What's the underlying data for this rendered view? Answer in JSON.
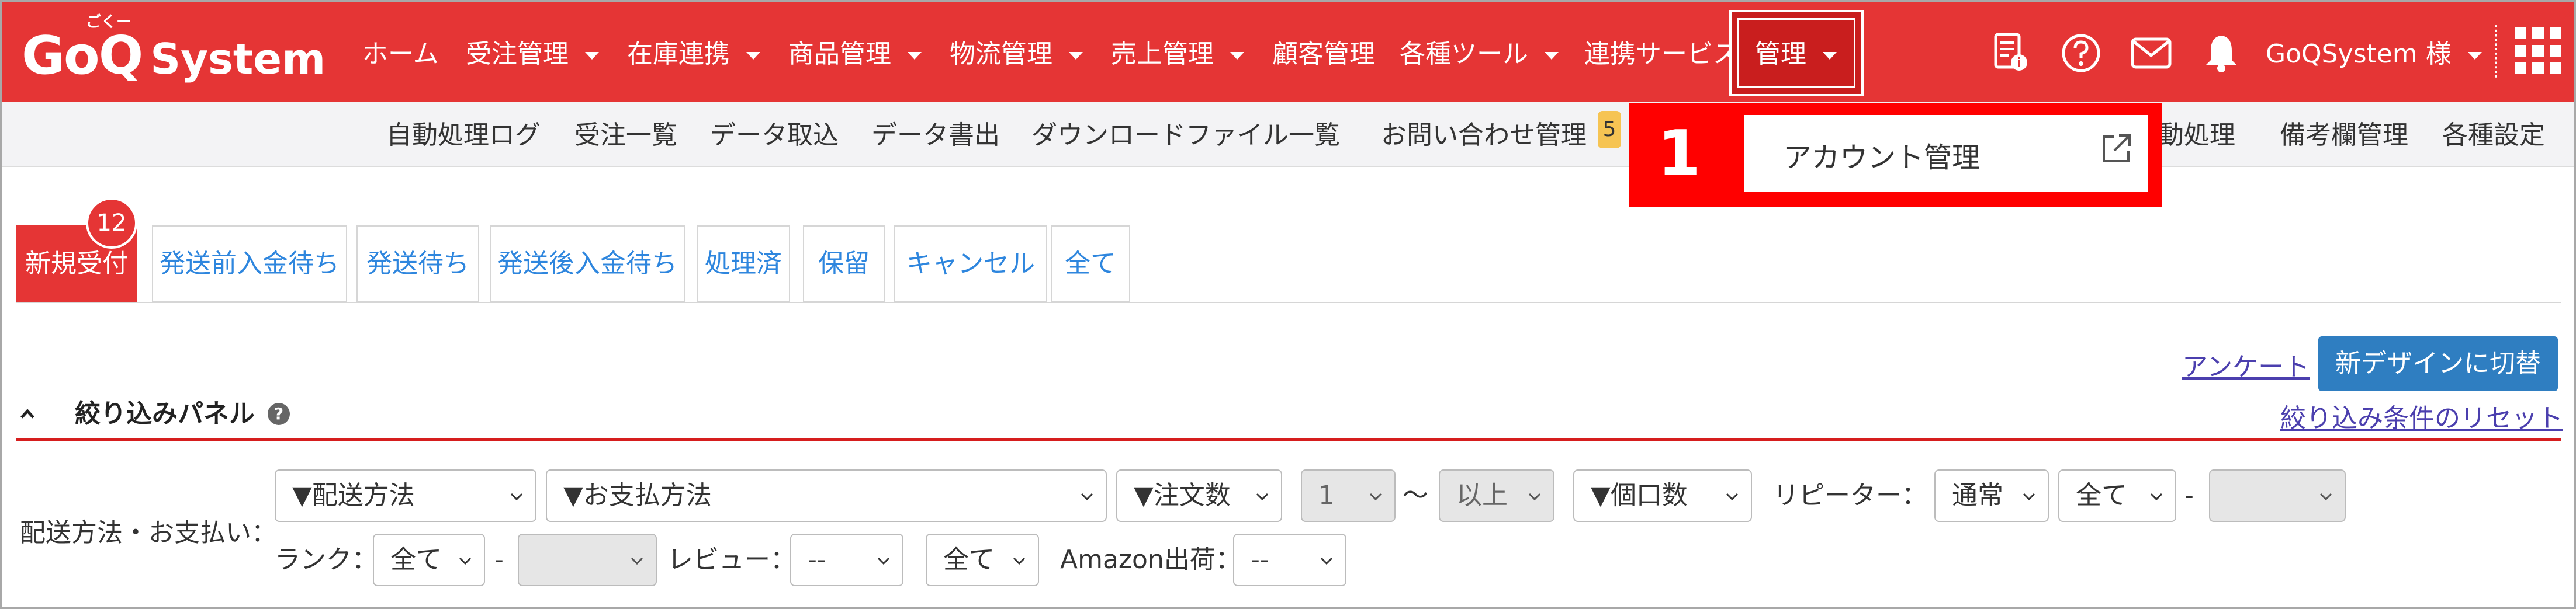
{
  "brand": {
    "name": "GoQ",
    "name_suffix": "System",
    "ruby": "ごくー"
  },
  "topnav": {
    "items": [
      "ホーム",
      "受注管理",
      "在庫連携",
      "商品管理",
      "物流管理",
      "売上管理",
      "顧客管理",
      "各種ツール",
      "連携サービス",
      "管理"
    ],
    "user": "GoQSystem 様"
  },
  "subnav": {
    "items": [
      "自動処理ログ",
      "受注一覧",
      "データ取込",
      "データ書出",
      "ダウンロードファイル一覧",
      "お問い合わせ管理",
      "動処理",
      "備考欄管理",
      "各種設定"
    ],
    "inquiry_badge": "5"
  },
  "dropdown": {
    "step": "1",
    "item": "アカウント管理"
  },
  "tabs": {
    "items": [
      "新規受付",
      "発送前入金待ち",
      "発送待ち",
      "発送後入金待ち",
      "処理済",
      "保留",
      "キャンセル",
      "全て"
    ],
    "new_count": "12"
  },
  "links": {
    "survey": "アンケート",
    "reset": "絞り込み条件のリセット"
  },
  "buttons": {
    "switch_design": "新デザインに切替"
  },
  "panel": {
    "title": "絞り込みパネル",
    "help": "?"
  },
  "filters": {
    "row_label": "配送方法・お支払い：",
    "shipping": "▼配送方法",
    "payment": "▼お支払方法",
    "order_count": "▼注文数",
    "order_count_num": "1",
    "tilde": "〜",
    "order_count_cmp": "以上",
    "parcels": "▼個口数",
    "repeater_label": "リピーター：",
    "repeater_type": "通常",
    "repeater_all": "全て",
    "dash": "-",
    "rank_label": "ランク：",
    "rank_value": "全て",
    "review_label": "レビュー：",
    "review_value": "--",
    "review_all": "全て",
    "amazon_label": "Amazon出荷：",
    "amazon_value": "--"
  },
  "colors": {
    "brand_red": "#e53535",
    "link_blue": "#2e86de",
    "button_blue": "#2f7ec1",
    "highlight_red": "#ff0000"
  },
  "icons": [
    "document-info-icon",
    "help-circle-icon",
    "mail-icon",
    "bell-icon",
    "app-grid-icon",
    "external-link-icon",
    "chevron-up-icon"
  ]
}
